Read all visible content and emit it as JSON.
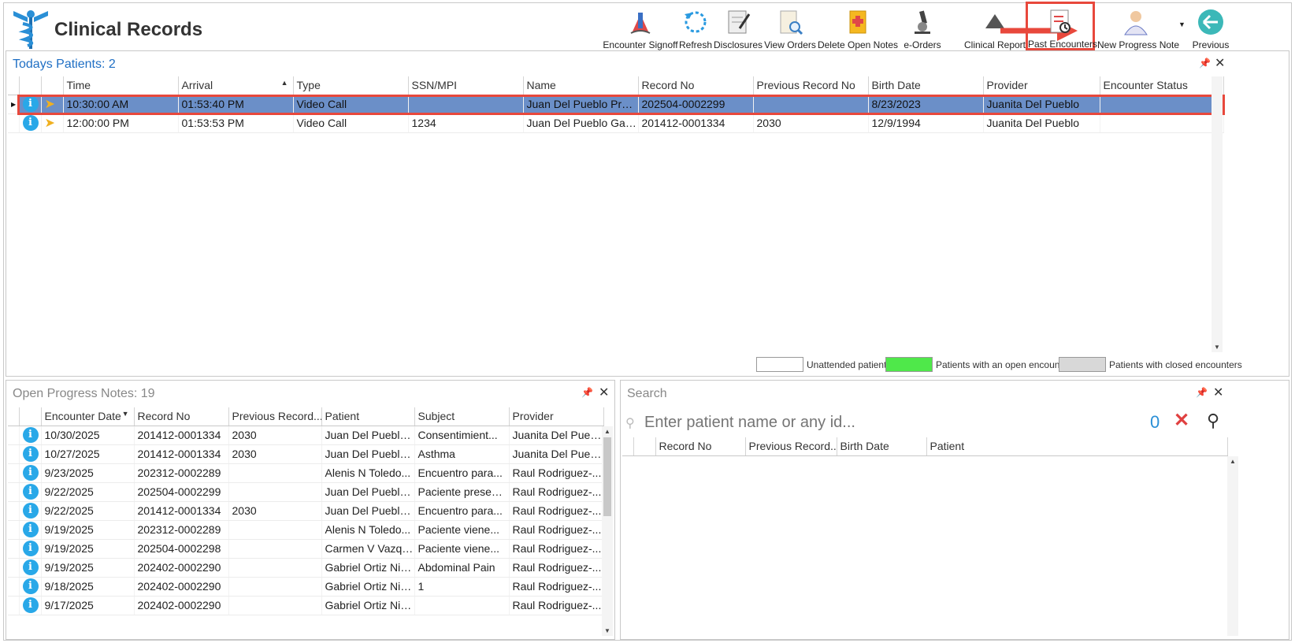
{
  "app": {
    "title": "Clinical Records"
  },
  "toolbar": [
    {
      "label": "Encounter Signoff",
      "icon": "signoff-icon"
    },
    {
      "label": "Refresh",
      "icon": "refresh-icon"
    },
    {
      "label": "Disclosures",
      "icon": "disclosures-icon"
    },
    {
      "label": "View Orders",
      "icon": "view-orders-icon"
    },
    {
      "label": "Delete Open Notes",
      "icon": "delete-notes-icon"
    },
    {
      "label": "e-Orders",
      "icon": "microscope-icon"
    },
    {
      "label": "Clinical Report",
      "icon": "clinical-report-icon"
    },
    {
      "label": "Past Encounters",
      "icon": "past-encounters-icon"
    },
    {
      "label": "New Progress Note",
      "icon": "doctor-icon"
    },
    {
      "label": "Previous",
      "icon": "back-arrow-icon"
    }
  ],
  "todays_patients": {
    "title_prefix": "Todays Patients:",
    "count": "2",
    "columns": [
      "Time",
      "Arrival",
      "Type",
      "SSN/MPI",
      "Name",
      "Record No",
      "Previous Record No",
      "Birth Date",
      "Provider",
      "Encounter Status"
    ],
    "rows": [
      [
        "10:30:00 AM",
        "01:53:40 PM",
        "Video Call",
        "",
        "Juan Del Pueblo Prue...",
        "202504-0002299",
        "",
        "8/23/2023",
        "Juanita Del Pueblo",
        ""
      ],
      [
        "12:00:00 PM",
        "01:53:53 PM",
        "Video Call",
        "1234",
        "Juan Del Pueblo Garcia",
        "201412-0001334",
        "2030",
        "12/9/1994",
        "Juanita Del Pueblo",
        ""
      ]
    ]
  },
  "legend": {
    "unattended": "Unattended patients",
    "open": "Patients with an open encounter",
    "closed": "Patients with closed encounters",
    "open_color": "#4fe84a",
    "closed_color": "#d8d8d8"
  },
  "open_notes": {
    "title_prefix": "Open Progress Notes:",
    "count": "19",
    "columns": [
      "Encounter Date",
      "Record No",
      "Previous Record...",
      "Patient",
      "Subject",
      "Provider"
    ],
    "rows": [
      [
        "10/30/2025",
        "201412-0001334",
        "2030",
        "Juan Del Pueblo...",
        "Consentimient...",
        "Juanita Del Pueblo"
      ],
      [
        "10/27/2025",
        "201412-0001334",
        "2030",
        "Juan Del Pueblo...",
        "Asthma",
        "Juanita Del Pueblo"
      ],
      [
        "9/23/2025",
        "202312-0002289",
        "",
        "Alenis N Toledo...",
        "Encuentro para...",
        "Raul Rodriguez-..."
      ],
      [
        "9/22/2025",
        "202504-0002299",
        "",
        "Juan Del Pueblo...",
        "Paciente present...",
        "Raul Rodriguez-..."
      ],
      [
        "9/22/2025",
        "201412-0001334",
        "2030",
        "Juan Del Pueblo...",
        "Encuentro para...",
        "Raul Rodriguez-..."
      ],
      [
        "9/19/2025",
        "202312-0002289",
        "",
        "Alenis N Toledo...",
        "Paciente viene...",
        "Raul Rodriguez-..."
      ],
      [
        "9/19/2025",
        "202504-0002298",
        "",
        "Carmen V Vazqu...",
        "Paciente viene...",
        "Raul Rodriguez-..."
      ],
      [
        "9/19/2025",
        "202402-0002290",
        "",
        "Gabriel Ortiz Nie...",
        "Abdominal Pain",
        "Raul Rodriguez-..."
      ],
      [
        "9/18/2025",
        "202402-0002290",
        "",
        "Gabriel Ortiz Nie...",
        "1",
        "Raul Rodriguez-..."
      ],
      [
        "9/17/2025",
        "202402-0002290",
        "",
        "Gabriel Ortiz Nie...",
        "",
        "Raul Rodriguez-..."
      ]
    ]
  },
  "search": {
    "title": "Search",
    "placeholder": "Enter patient name or any id...",
    "count": "0",
    "columns": [
      "Record No",
      "Previous Record...",
      "Birth Date",
      "Patient"
    ]
  },
  "colors": {
    "accent": "#1f6fc4",
    "selected_row": "#6b8fc8",
    "highlight": "#e8483c"
  }
}
